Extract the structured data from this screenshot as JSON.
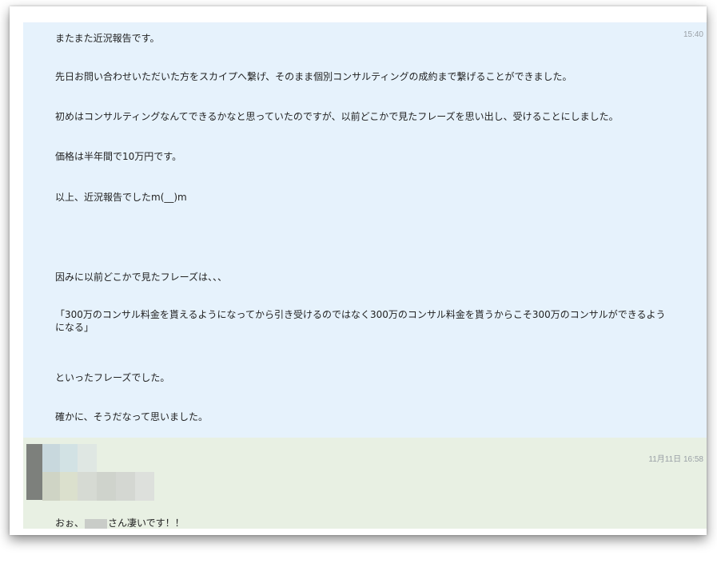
{
  "message_1": {
    "timestamp": "15:40",
    "lines": [
      "またまた近況報告です。",
      "先日お問い合わせいただいた方をスカイプへ繋げ、そのまま個別コンサルティングの成約まで繋げることができました。",
      "初めはコンサルティングなんてできるかなと思っていたのですが、以前どこかで見たフレーズを思い出し、受けることにしました。",
      "価格は半年間で10万円です。",
      "以上、近況報告でしたm(__)m",
      "因みに以前どこかで見たフレーズは、、、",
      "「300万のコンサル料金を貰えるようになってから引き受けるのではなく300万のコンサル料金を貰うからこそ300万のコンサルができるようになる」",
      "といったフレーズでした。",
      "確かに、そうだなって思いました。"
    ]
  },
  "message_2": {
    "timestamp": "11月11日 16:58",
    "text_prefix": "おぉ、",
    "text_suffix": "さん凄いです！！"
  }
}
